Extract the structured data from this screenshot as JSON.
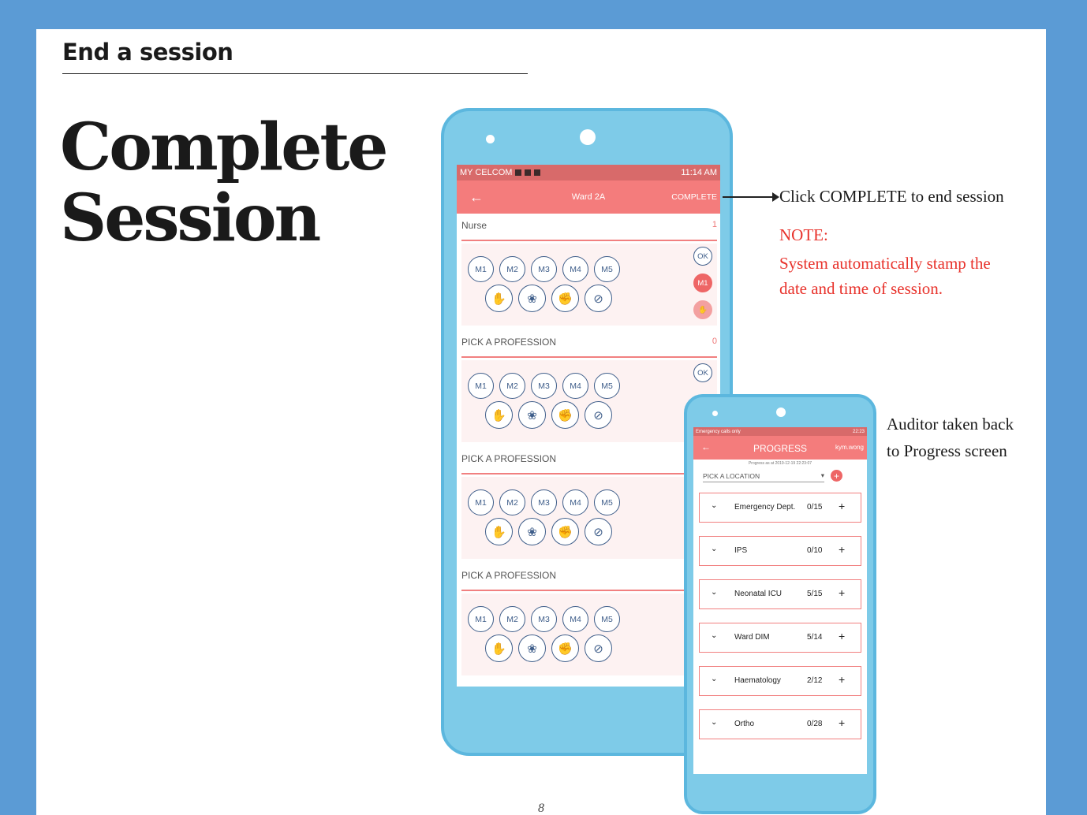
{
  "section_title": "End a session",
  "big_title_line1": "Complete",
  "big_title_line2": "Session",
  "page_number": "8",
  "phone1": {
    "status_left": "MY CELCOM",
    "status_right": "11:14 AM",
    "back_glyph": "←",
    "title": "Ward 2A",
    "complete_label": "COMPLETE",
    "groups": [
      {
        "label": "Nurse",
        "count": "1"
      },
      {
        "label": "PICK A PROFESSION",
        "count": "0"
      },
      {
        "label": "PICK A PROFESSION",
        "count": ""
      },
      {
        "label": "PICK A PROFESSION",
        "count": ""
      }
    ],
    "moments": [
      "M1",
      "M2",
      "M3",
      "M4",
      "M5"
    ],
    "actions": [
      "handrub-icon",
      "handwash-icon",
      "glove-icon",
      "no-action-icon"
    ],
    "side_ok": "OK",
    "side_m1": "M1"
  },
  "annotations": {
    "click": "Click COMPLETE to end session",
    "note_title": "NOTE:",
    "note_line1": "System automatically stamp the",
    "note_line2": "date and time of session.",
    "back_line1": "Auditor taken back",
    "back_line2": "to Progress screen"
  },
  "phone2": {
    "status_left": "Emergency calls only",
    "status_right": "22:23",
    "back_glyph": "←",
    "title": "PROGRESS",
    "user": "kym.wong",
    "stamp": "Progress as at 2019-12-19 22:23:07",
    "location_placeholder": "PICK A LOCATION",
    "wards": [
      {
        "name": "Emergency Dept.",
        "count": "0/15"
      },
      {
        "name": "IPS",
        "count": "0/10"
      },
      {
        "name": "Neonatal ICU",
        "count": "5/15"
      },
      {
        "name": "Ward DIM",
        "count": "5/14"
      },
      {
        "name": "Haematology",
        "count": "2/12"
      },
      {
        "name": "Ortho",
        "count": "0/28"
      }
    ]
  },
  "colors": {
    "frame_blue": "#5b9bd5",
    "phone_blue": "#7ecbe8",
    "app_red": "#f47c7c",
    "note_red": "#e8322b"
  }
}
